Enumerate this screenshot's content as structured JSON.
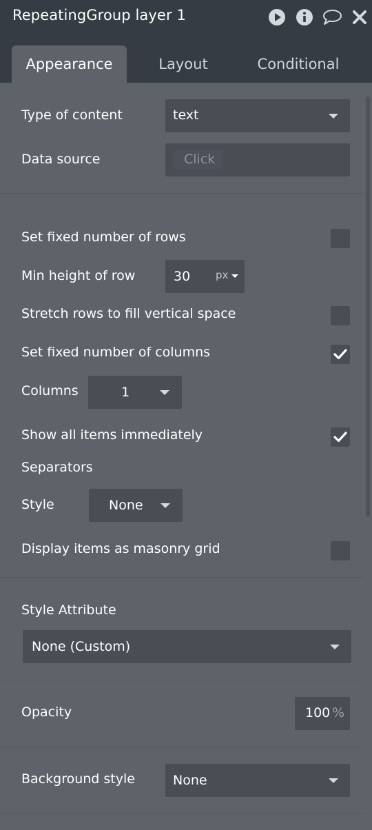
{
  "window": {
    "title": "RepeatingGroup layer 1"
  },
  "tabs": [
    "Appearance",
    "Layout",
    "Conditional"
  ],
  "content": {
    "type_of_content": {
      "label": "Type of content",
      "value": "text"
    },
    "data_source": {
      "label": "Data source",
      "placeholder": "Click"
    },
    "fixed_rows": {
      "label": "Set fixed number of rows",
      "checked": false
    },
    "min_height": {
      "label": "Min height of row",
      "value": "30",
      "unit": "px"
    },
    "stretch_rows": {
      "label": "Stretch rows to fill vertical space",
      "checked": false
    },
    "fixed_columns": {
      "label": "Set fixed number of columns",
      "checked": true
    },
    "columns": {
      "label": "Columns",
      "value": "1"
    },
    "show_all": {
      "label": "Show all items immediately",
      "checked": true
    },
    "separators": {
      "label": "Separators"
    },
    "style": {
      "label": "Style",
      "value": "None"
    },
    "masonry": {
      "label": "Display items as masonry grid",
      "checked": false
    },
    "style_attribute": {
      "label": "Style Attribute",
      "value": "None (Custom)"
    },
    "opacity": {
      "label": "Opacity",
      "value": "100",
      "unit": "%"
    },
    "background_style": {
      "label": "Background style",
      "value": "None"
    }
  },
  "icons": [
    "play-icon",
    "info-icon",
    "comment-icon",
    "close-icon",
    "dropdown-caret-icon",
    "checkmark-icon"
  ],
  "colors": {
    "panel": "#5e636a",
    "header": "#363c43",
    "field": "#494e55"
  }
}
